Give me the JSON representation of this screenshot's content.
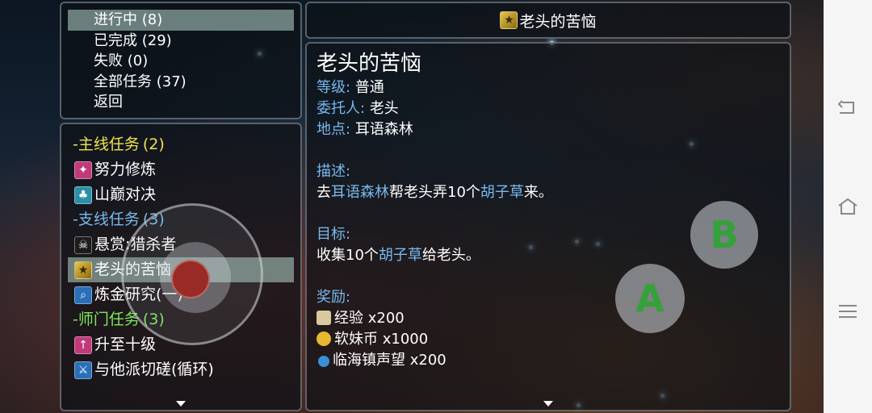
{
  "filters": [
    {
      "label": "进行中 (8)",
      "selected": true
    },
    {
      "label": "已完成 (29)",
      "selected": false
    },
    {
      "label": "失败 (0)",
      "selected": false
    },
    {
      "label": "全部任务 (37)",
      "selected": false
    },
    {
      "label": "返回",
      "selected": false
    }
  ],
  "quest_list": {
    "main": {
      "title": "-主线任务",
      "count": "(2)",
      "color": "#f0e34b"
    },
    "main_items": [
      {
        "label": "努力修炼",
        "icon": "training-icon"
      },
      {
        "label": "山巅对决",
        "icon": "tree-icon"
      }
    ],
    "side": {
      "title": "-支线任务",
      "count": "(3)",
      "color": "#77b9ee"
    },
    "side_items": [
      {
        "label": "悬赏:猎杀者",
        "icon": "skull-icon"
      },
      {
        "label": "老头的苦恼",
        "icon": "star-scroll-icon",
        "selected": true
      },
      {
        "label": "炼金研究(一)",
        "icon": "magnifier-icon"
      }
    ],
    "master": {
      "title": "-师门任务",
      "count": "(3)",
      "color": "#7fe85a"
    },
    "master_items": [
      {
        "label": "升至十级",
        "icon": "levelup-icon"
      },
      {
        "label": "与他派切磋(循环)",
        "icon": "duel-icon"
      }
    ]
  },
  "detail": {
    "header_title": "老头的苦恼",
    "title": "老头的苦恼",
    "level_label": "等级:",
    "level_value": "普通",
    "client_label": "委托人:",
    "client_value": "老头",
    "location_label": "地点:",
    "location_value": "耳语森林",
    "desc_label": "描述:",
    "desc_parts": [
      "去",
      "耳语森林",
      "帮老头弄10个",
      "胡子草",
      "来。"
    ],
    "goal_label": "目标:",
    "goal_parts": [
      "收集10个",
      "胡子草",
      "给老头。"
    ],
    "reward_label": "奖励:",
    "rewards": [
      {
        "text": "经验 x200",
        "icon": "exp-scroll-icon",
        "color": "#d8c9a0"
      },
      {
        "text": "软妹币 x1000",
        "icon": "coin-icon",
        "color": "#e8b830"
      },
      {
        "text": "临海镇声望 x200",
        "icon": "reputation-icon",
        "color": "#3a8fd6"
      }
    ]
  },
  "buttons": {
    "a": "A",
    "b": "B"
  }
}
